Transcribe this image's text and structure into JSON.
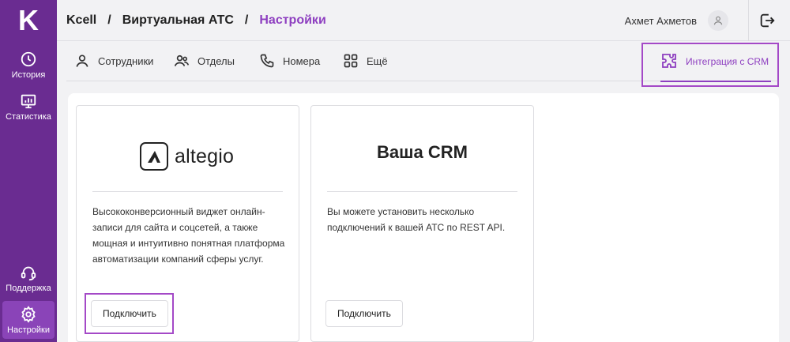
{
  "app": {
    "logo_letter": "K"
  },
  "sidebar": {
    "items": [
      {
        "label": "История",
        "icon": "clock-icon"
      },
      {
        "label": "Статистика",
        "icon": "monitor-chart-icon"
      },
      {
        "label": "Поддержка",
        "icon": "headset-icon"
      },
      {
        "label": "Настройки",
        "icon": "gear-icon",
        "active": true
      }
    ]
  },
  "header": {
    "breadcrumbs": [
      "Kcell",
      "Виртуальная АТС",
      "Настройки"
    ],
    "separator": "/",
    "user_name": "Ахмет Ахметов"
  },
  "tabs": [
    {
      "label": "Сотрудники",
      "icon": "person-icon"
    },
    {
      "label": "Отделы",
      "icon": "people-icon"
    },
    {
      "label": "Номера",
      "icon": "phone-icon"
    },
    {
      "label": "Ещё",
      "icon": "grid-icon"
    },
    {
      "label": "Интеграция с CRM",
      "icon": "puzzle-icon",
      "active": true
    }
  ],
  "cards": [
    {
      "logo_text": "altegio",
      "description": "Высококонверсионный виджет онлайн-записи для сайта и соцсетей, а также мощная и интуитивно понятная платформа автоматизации компаний сферы услуг.",
      "button": "Подключить"
    },
    {
      "title": "Ваша CRM",
      "description": "Вы можете установить несколько подключений к вашей АТС по REST API.",
      "button": "Подключить"
    }
  ],
  "colors": {
    "sidebar": "#6a2c91",
    "accent": "#8e3fc0",
    "highlight": "#a449c7"
  }
}
